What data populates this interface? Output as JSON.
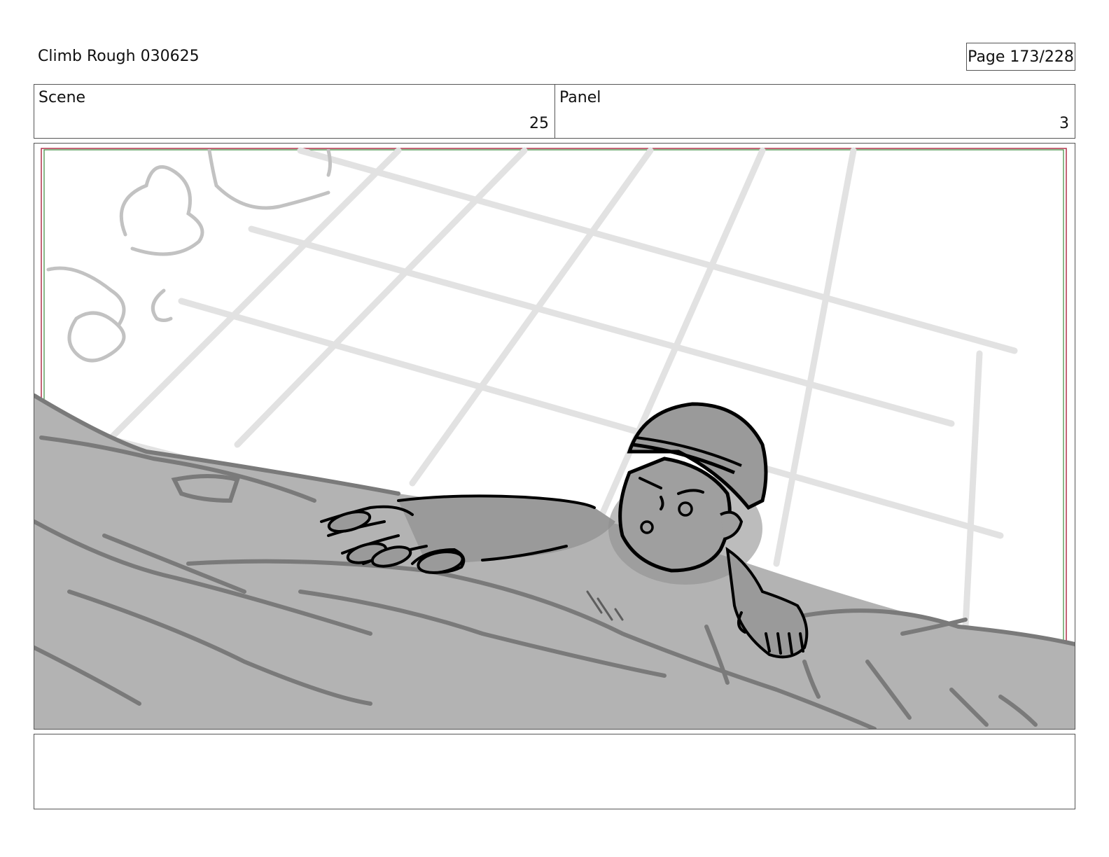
{
  "document": {
    "title": "Climb Rough 030625",
    "page_indicator": "Page 173/228"
  },
  "header": {
    "scene_label": "Scene",
    "scene_value": "25",
    "panel_label": "Panel",
    "panel_value": "3"
  },
  "panel_image": {
    "subject": "rough storyboard sketch of a helmeted climber reaching over a rock ledge"
  },
  "notes": {
    "text": ""
  }
}
